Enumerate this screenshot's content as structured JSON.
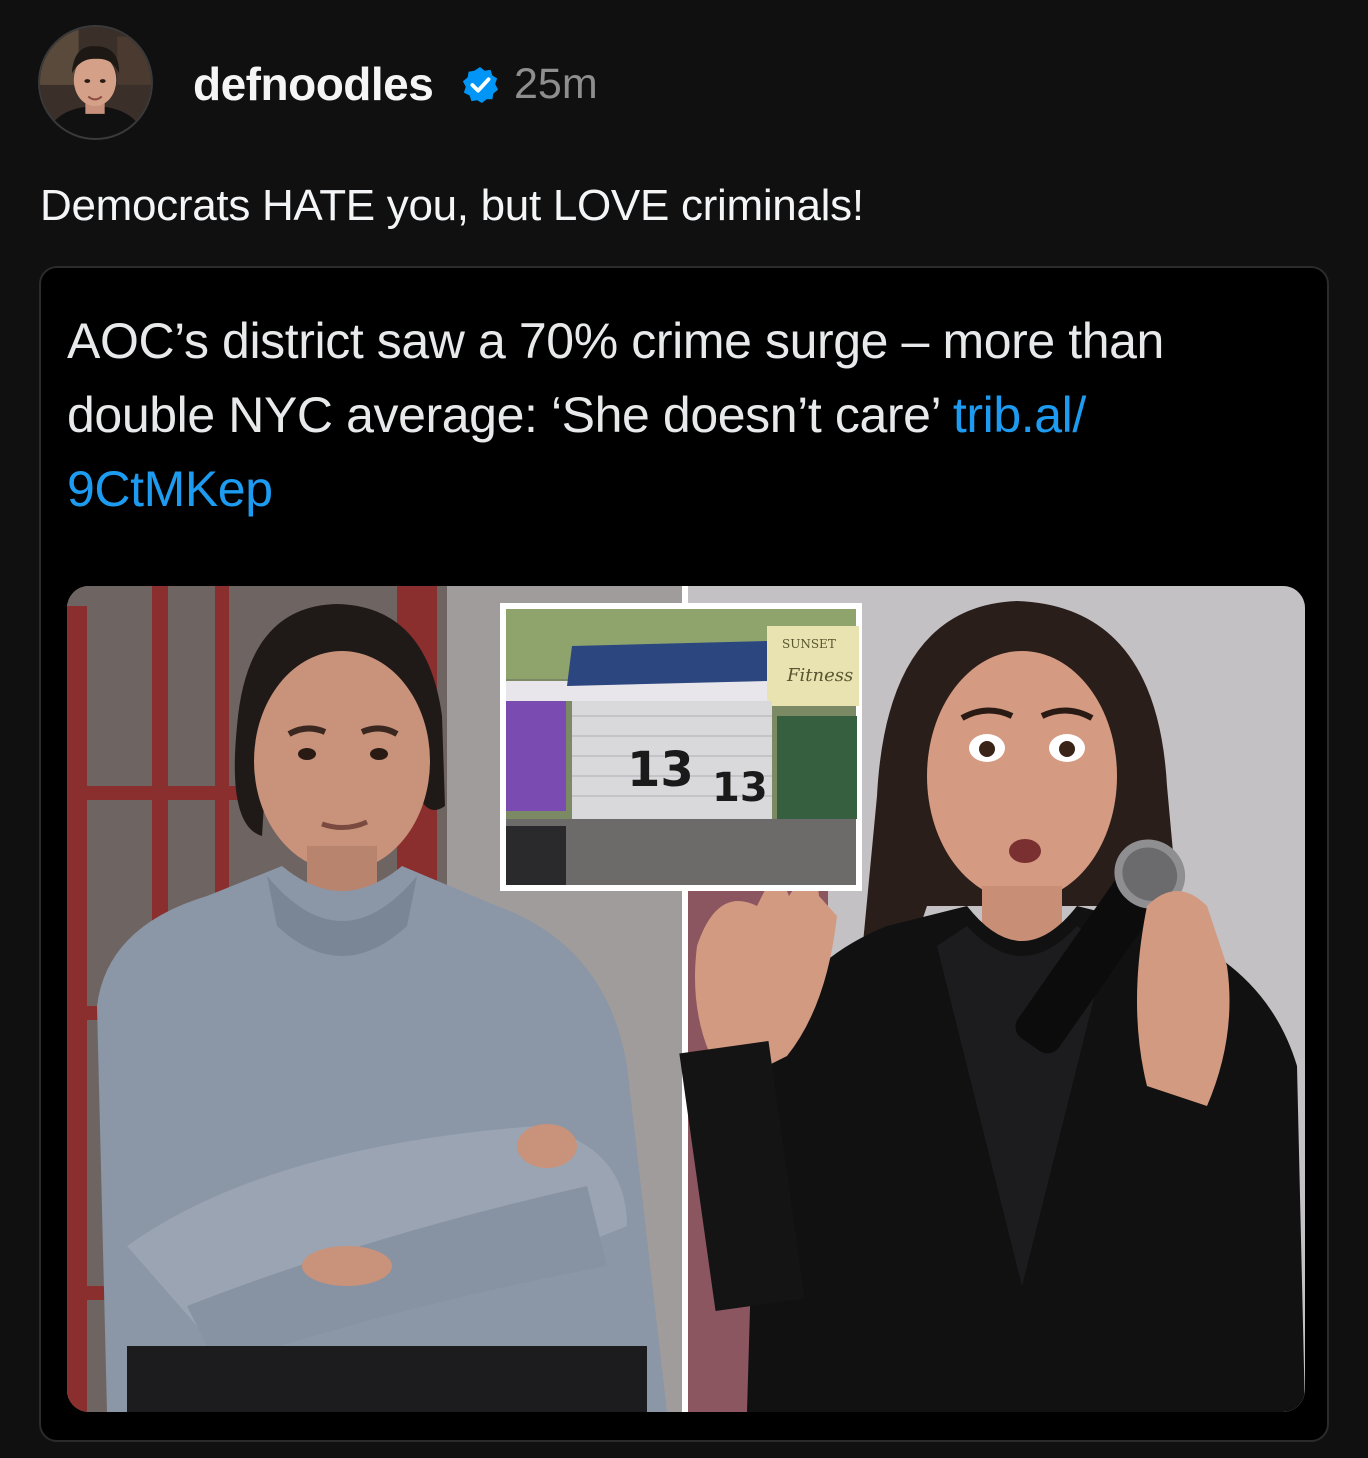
{
  "post": {
    "username": "defnoodles",
    "timestamp": "25m",
    "caption": "Democrats HATE you, but LOVE criminals!",
    "verified_icon": "verified-badge-icon",
    "accent_color": "#1d9bf0"
  },
  "quote": {
    "headline": "AOC’s district saw a 70% crime surge – more than double NYC average: ‘She doesn’t care’ ",
    "link": "trib.al/\n9CtMKep"
  },
  "media": {
    "graffiti": [
      "13",
      "13"
    ],
    "signs": [
      "SUNSET",
      "Fitness"
    ]
  }
}
